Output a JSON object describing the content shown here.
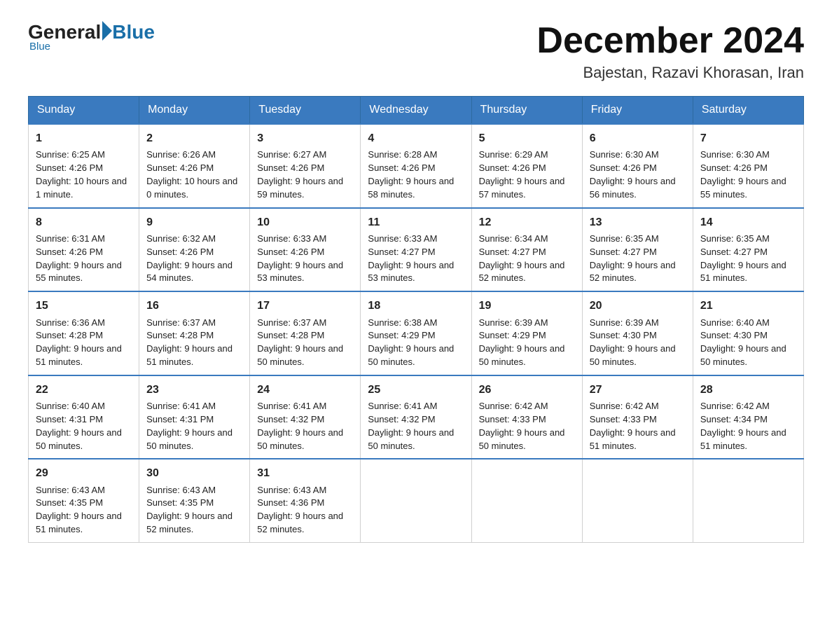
{
  "logo": {
    "general": "General",
    "blue": "Blue",
    "underline": "Blue"
  },
  "header": {
    "title": "December 2024",
    "subtitle": "Bajestan, Razavi Khorasan, Iran"
  },
  "days": [
    "Sunday",
    "Monday",
    "Tuesday",
    "Wednesday",
    "Thursday",
    "Friday",
    "Saturday"
  ],
  "weeks": [
    [
      {
        "day": 1,
        "sunrise": "6:25 AM",
        "sunset": "4:26 PM",
        "daylight": "10 hours and 1 minute."
      },
      {
        "day": 2,
        "sunrise": "6:26 AM",
        "sunset": "4:26 PM",
        "daylight": "10 hours and 0 minutes."
      },
      {
        "day": 3,
        "sunrise": "6:27 AM",
        "sunset": "4:26 PM",
        "daylight": "9 hours and 59 minutes."
      },
      {
        "day": 4,
        "sunrise": "6:28 AM",
        "sunset": "4:26 PM",
        "daylight": "9 hours and 58 minutes."
      },
      {
        "day": 5,
        "sunrise": "6:29 AM",
        "sunset": "4:26 PM",
        "daylight": "9 hours and 57 minutes."
      },
      {
        "day": 6,
        "sunrise": "6:30 AM",
        "sunset": "4:26 PM",
        "daylight": "9 hours and 56 minutes."
      },
      {
        "day": 7,
        "sunrise": "6:30 AM",
        "sunset": "4:26 PM",
        "daylight": "9 hours and 55 minutes."
      }
    ],
    [
      {
        "day": 8,
        "sunrise": "6:31 AM",
        "sunset": "4:26 PM",
        "daylight": "9 hours and 55 minutes."
      },
      {
        "day": 9,
        "sunrise": "6:32 AM",
        "sunset": "4:26 PM",
        "daylight": "9 hours and 54 minutes."
      },
      {
        "day": 10,
        "sunrise": "6:33 AM",
        "sunset": "4:26 PM",
        "daylight": "9 hours and 53 minutes."
      },
      {
        "day": 11,
        "sunrise": "6:33 AM",
        "sunset": "4:27 PM",
        "daylight": "9 hours and 53 minutes."
      },
      {
        "day": 12,
        "sunrise": "6:34 AM",
        "sunset": "4:27 PM",
        "daylight": "9 hours and 52 minutes."
      },
      {
        "day": 13,
        "sunrise": "6:35 AM",
        "sunset": "4:27 PM",
        "daylight": "9 hours and 52 minutes."
      },
      {
        "day": 14,
        "sunrise": "6:35 AM",
        "sunset": "4:27 PM",
        "daylight": "9 hours and 51 minutes."
      }
    ],
    [
      {
        "day": 15,
        "sunrise": "6:36 AM",
        "sunset": "4:28 PM",
        "daylight": "9 hours and 51 minutes."
      },
      {
        "day": 16,
        "sunrise": "6:37 AM",
        "sunset": "4:28 PM",
        "daylight": "9 hours and 51 minutes."
      },
      {
        "day": 17,
        "sunrise": "6:37 AM",
        "sunset": "4:28 PM",
        "daylight": "9 hours and 50 minutes."
      },
      {
        "day": 18,
        "sunrise": "6:38 AM",
        "sunset": "4:29 PM",
        "daylight": "9 hours and 50 minutes."
      },
      {
        "day": 19,
        "sunrise": "6:39 AM",
        "sunset": "4:29 PM",
        "daylight": "9 hours and 50 minutes."
      },
      {
        "day": 20,
        "sunrise": "6:39 AM",
        "sunset": "4:30 PM",
        "daylight": "9 hours and 50 minutes."
      },
      {
        "day": 21,
        "sunrise": "6:40 AM",
        "sunset": "4:30 PM",
        "daylight": "9 hours and 50 minutes."
      }
    ],
    [
      {
        "day": 22,
        "sunrise": "6:40 AM",
        "sunset": "4:31 PM",
        "daylight": "9 hours and 50 minutes."
      },
      {
        "day": 23,
        "sunrise": "6:41 AM",
        "sunset": "4:31 PM",
        "daylight": "9 hours and 50 minutes."
      },
      {
        "day": 24,
        "sunrise": "6:41 AM",
        "sunset": "4:32 PM",
        "daylight": "9 hours and 50 minutes."
      },
      {
        "day": 25,
        "sunrise": "6:41 AM",
        "sunset": "4:32 PM",
        "daylight": "9 hours and 50 minutes."
      },
      {
        "day": 26,
        "sunrise": "6:42 AM",
        "sunset": "4:33 PM",
        "daylight": "9 hours and 50 minutes."
      },
      {
        "day": 27,
        "sunrise": "6:42 AM",
        "sunset": "4:33 PM",
        "daylight": "9 hours and 51 minutes."
      },
      {
        "day": 28,
        "sunrise": "6:42 AM",
        "sunset": "4:34 PM",
        "daylight": "9 hours and 51 minutes."
      }
    ],
    [
      {
        "day": 29,
        "sunrise": "6:43 AM",
        "sunset": "4:35 PM",
        "daylight": "9 hours and 51 minutes."
      },
      {
        "day": 30,
        "sunrise": "6:43 AM",
        "sunset": "4:35 PM",
        "daylight": "9 hours and 52 minutes."
      },
      {
        "day": 31,
        "sunrise": "6:43 AM",
        "sunset": "4:36 PM",
        "daylight": "9 hours and 52 minutes."
      },
      null,
      null,
      null,
      null
    ]
  ],
  "labels": {
    "sunrise": "Sunrise:",
    "sunset": "Sunset:",
    "daylight": "Daylight:"
  }
}
